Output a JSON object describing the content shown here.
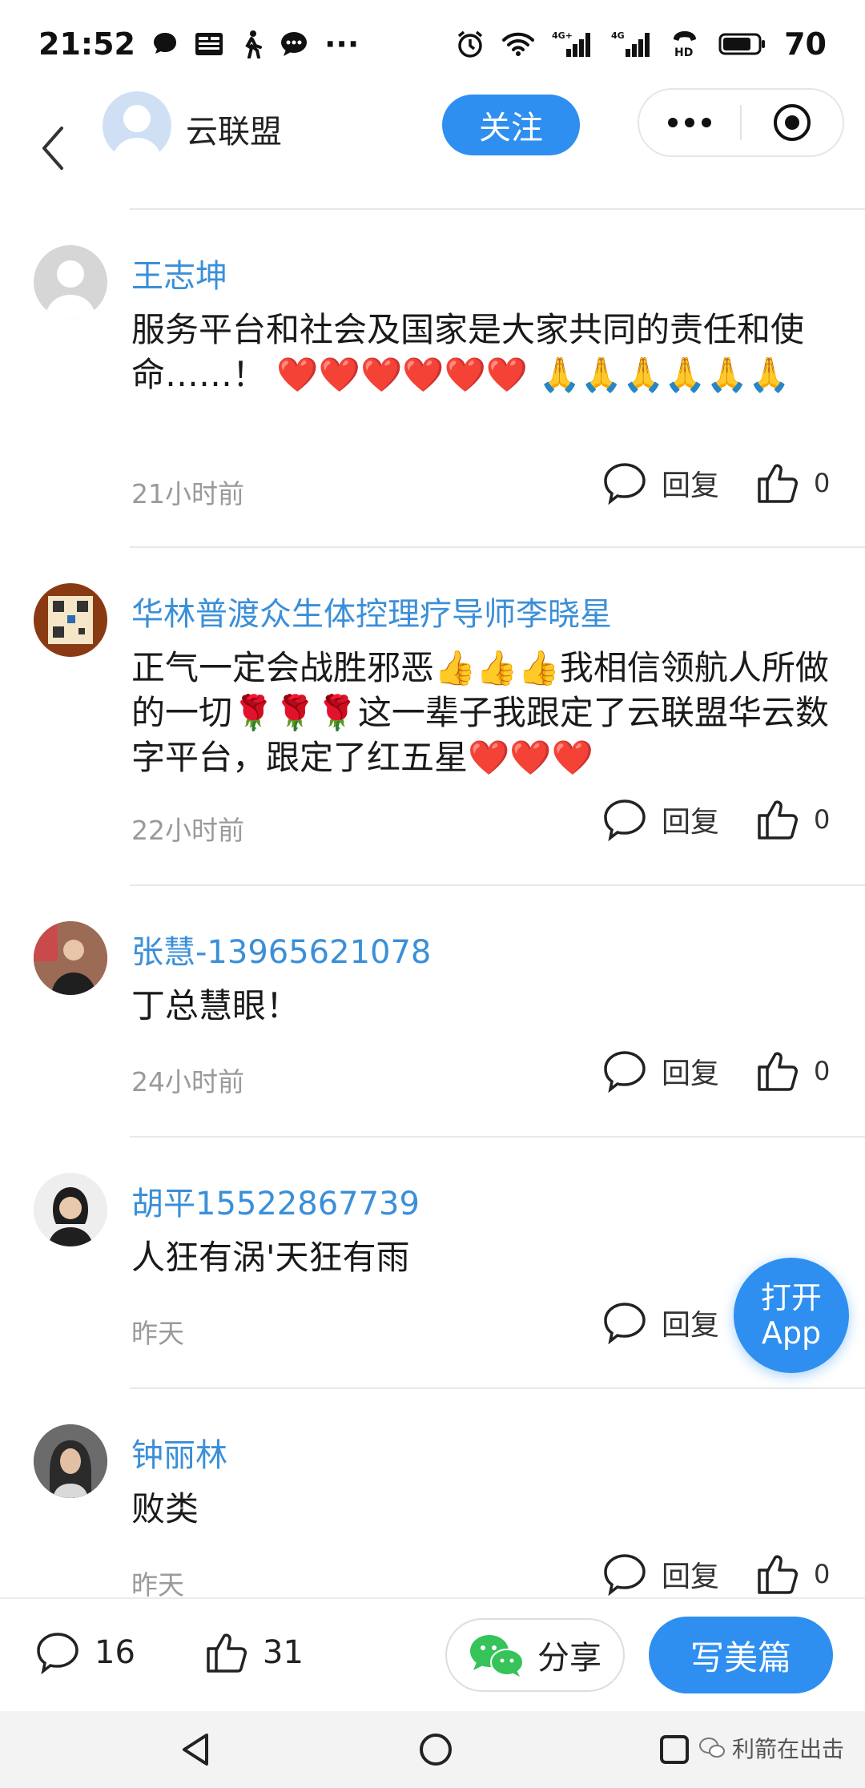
{
  "status_bar": {
    "time": "21:52",
    "battery": "70",
    "network_a": "4G+",
    "network_b": "4G",
    "hd": "HD",
    "more": "···"
  },
  "header": {
    "title": "云联盟",
    "follow_label": "关注"
  },
  "comments": [
    {
      "name": "王志坤",
      "text": "服务平台和社会及国家是大家共同的责任和使命……！ ❤️❤️❤️❤️❤️❤️ 🙏🙏🙏🙏🙏🙏",
      "time": "21小时前",
      "reply_label": "回复",
      "likes": "0"
    },
    {
      "name": "华林普渡众生体控理疗导师李晓星",
      "text": "正气一定会战胜邪恶👍👍👍我相信领航人所做的一切🌹🌹🌹这一辈子我跟定了云联盟华云数字平台，跟定了红五星❤️❤️❤️",
      "time": "22小时前",
      "reply_label": "回复",
      "likes": "0"
    },
    {
      "name": "张慧-13965621078",
      "text": "丁总慧眼！",
      "time": "24小时前",
      "reply_label": "回复",
      "likes": "0"
    },
    {
      "name": "胡平15522867739",
      "text": "人狂有涡'天狂有雨",
      "time": "昨天",
      "reply_label": "回复",
      "likes": ""
    },
    {
      "name": "钟丽林",
      "text": "败类",
      "time": "昨天",
      "reply_label": "回复",
      "likes": "0"
    }
  ],
  "open_app": {
    "line1": "打开",
    "line2": "App"
  },
  "bottom_bar": {
    "comment_count": "16",
    "like_count": "31",
    "share_label": "分享",
    "write_label": "写美篇"
  },
  "watermark": "利箭在出击",
  "colors": {
    "accent": "#2e8ff0",
    "name": "#3b8fd8"
  }
}
